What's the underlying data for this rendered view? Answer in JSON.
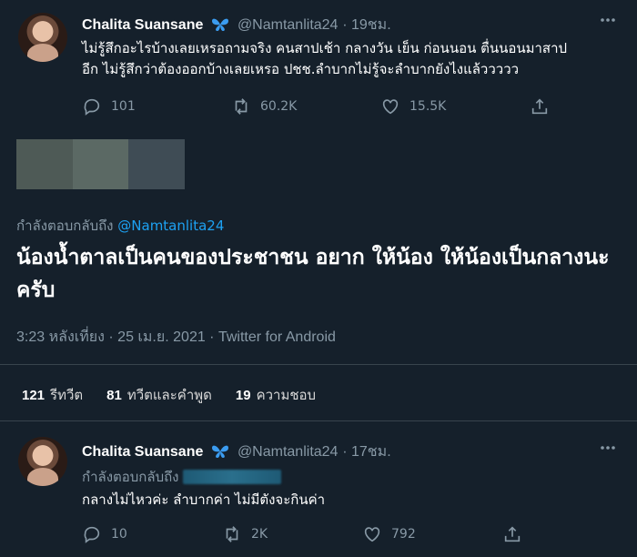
{
  "tweet1": {
    "display_name": "Chalita Suansane",
    "handle": "@Namtanlita24",
    "time": "· 19ชม.",
    "text_line1": "ไม่รู้สึกอะไรบ้างเลยเหรอถามจริง คนสาปเช้า กลางวัน เย็น ก่อนนอน ตื่นนอนมาสาป",
    "text_line2": "อีก ไม่รู้สึกว่าต้องออกบ้างเลยเหรอ ปชช.ลำบากไม่รู้จะลำบากยังไงแล้ววววว",
    "replies": "101",
    "retweets": "60.2K",
    "likes": "15.5K"
  },
  "main_tweet": {
    "replying_label": "กำลังตอบกลับถึง",
    "replying_to": "@Namtanlita24",
    "text": "น้องน้ำตาลเป็นคนของประชาชน อยาก ให้น้อง ให้น้องเป็นกลางนะครับ",
    "timestamp": "3:23 หลังเที่ยง · 25 เม.ย. 2021 · Twitter for Android",
    "retweet_count": "121",
    "retweet_label": "รีทวีต",
    "quote_count": "81",
    "quote_label": "ทวีตและคำพูด",
    "like_count": "19",
    "like_label": "ความชอบ"
  },
  "tweet3": {
    "display_name": "Chalita Suansane",
    "handle": "@Namtanlita24",
    "time": "· 17ชม.",
    "replying_label": "กำลังตอบกลับถึง",
    "text": "กลางไม่ไหวค่ะ ลำบากค่า ไม่มีตังจะกินค่า",
    "replies": "10",
    "retweets": "2K",
    "likes": "792"
  },
  "colors": {
    "background": "#15202b",
    "accent": "#1da1f2",
    "muted": "#8899a6",
    "verified": "#3b9cf0"
  },
  "icons": [
    "reply-icon",
    "retweet-icon",
    "like-icon",
    "share-icon",
    "more-icon",
    "butterfly-icon"
  ]
}
